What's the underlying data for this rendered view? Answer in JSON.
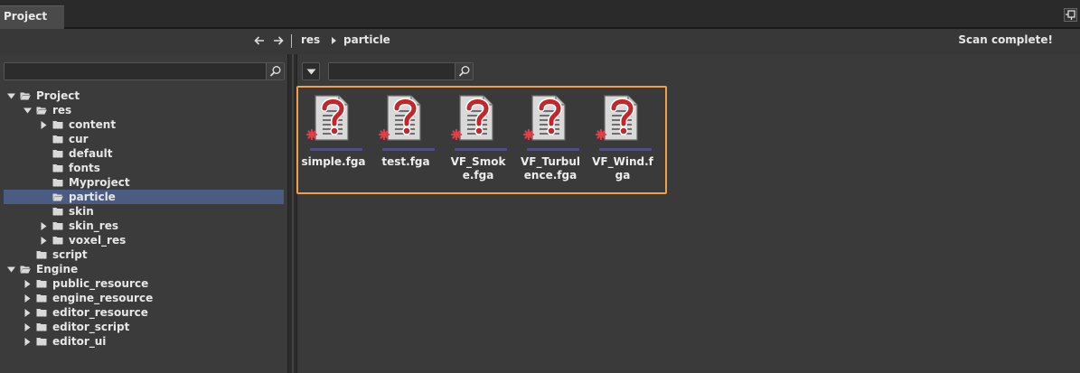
{
  "panel": {
    "tab_label": "Project",
    "pin_icon": "pin-icon"
  },
  "toolbar": {
    "back_icon": "arrow-left-icon",
    "forward_icon": "arrow-right-icon",
    "breadcrumb": [
      "res",
      "particle"
    ],
    "status": "Scan complete!"
  },
  "left_search": {
    "value": "",
    "placeholder": ""
  },
  "right_search": {
    "value": "",
    "placeholder": ""
  },
  "tree": [
    {
      "label": "Project",
      "depth": 0,
      "expanded": true,
      "has_children": true
    },
    {
      "label": "res",
      "depth": 1,
      "expanded": true,
      "has_children": true
    },
    {
      "label": "content",
      "depth": 2,
      "expanded": false,
      "has_children": true
    },
    {
      "label": "cur",
      "depth": 2,
      "expanded": false,
      "has_children": false
    },
    {
      "label": "default",
      "depth": 2,
      "expanded": false,
      "has_children": false
    },
    {
      "label": "fonts",
      "depth": 2,
      "expanded": false,
      "has_children": false
    },
    {
      "label": "Myproject",
      "depth": 2,
      "expanded": false,
      "has_children": false
    },
    {
      "label": "particle",
      "depth": 2,
      "expanded": false,
      "has_children": false,
      "selected": true
    },
    {
      "label": "skin",
      "depth": 2,
      "expanded": false,
      "has_children": false
    },
    {
      "label": "skin_res",
      "depth": 2,
      "expanded": false,
      "has_children": true
    },
    {
      "label": "voxel_res",
      "depth": 2,
      "expanded": false,
      "has_children": true
    },
    {
      "label": "script",
      "depth": 1,
      "expanded": false,
      "has_children": false
    },
    {
      "label": "Engine",
      "depth": 0,
      "expanded": true,
      "has_children": true
    },
    {
      "label": "public_resource",
      "depth": 1,
      "expanded": false,
      "has_children": true
    },
    {
      "label": "engine_resource",
      "depth": 1,
      "expanded": false,
      "has_children": true
    },
    {
      "label": "editor_resource",
      "depth": 1,
      "expanded": false,
      "has_children": true
    },
    {
      "label": "editor_script",
      "depth": 1,
      "expanded": false,
      "has_children": true
    },
    {
      "label": "editor_ui",
      "depth": 1,
      "expanded": false,
      "has_children": true
    }
  ],
  "files": [
    {
      "name": "simple.fga",
      "icon": "unknown-file-icon"
    },
    {
      "name": "test.fga",
      "icon": "unknown-file-icon"
    },
    {
      "name": "VF_Smoke.fga",
      "icon": "unknown-file-icon"
    },
    {
      "name": "VF_Turbulence.fga",
      "icon": "unknown-file-icon"
    },
    {
      "name": "VF_Wind.fga",
      "icon": "unknown-file-icon"
    }
  ],
  "colors": {
    "selection_border": "#f0a045",
    "tree_selected": "#4b5c83",
    "file_bar": "#4f4d82",
    "icon_question": "#c0282c"
  }
}
